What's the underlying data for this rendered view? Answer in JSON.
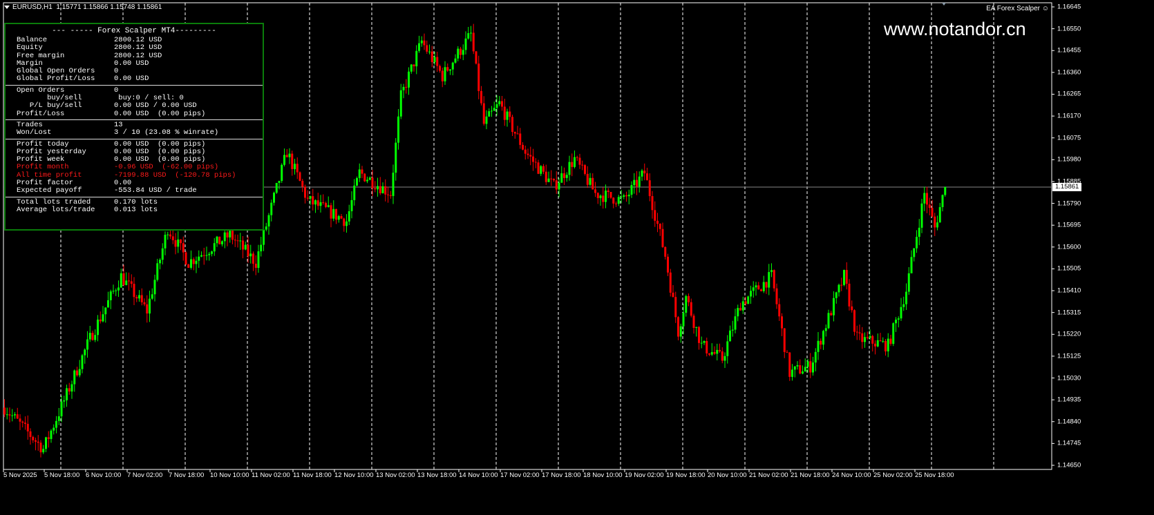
{
  "header": {
    "symbol": "EURUSD,H1",
    "ohlc": "1.15771 1.15866 1.15748 1.15861"
  },
  "ea_label": "EA Forex Scalper",
  "watermark": "www.notandor.cn",
  "panel": {
    "title": "--- ----- Forex Scalper MT4---------",
    "sections": [
      [
        [
          "Balance",
          "2800.12 USD"
        ],
        [
          "Equity",
          "2800.12 USD"
        ],
        [
          "Free margin",
          "2800.12 USD"
        ],
        [
          "Margin",
          "0.00 USD"
        ],
        [
          "Global Open Orders",
          "0"
        ],
        [
          "Global Profit/Loss",
          "0.00 USD"
        ]
      ],
      [
        [
          "Open Orders",
          "0"
        ],
        [
          "       buy/sell",
          " buy:0 / sell: 0"
        ],
        [
          "   P/L buy/sell",
          "0.00 USD / 0.00 USD"
        ],
        [
          "Profit/Loss",
          "0.00 USD  (0.00 pips)"
        ]
      ],
      [
        [
          "Trades",
          "13"
        ],
        [
          "Won/Lost",
          "3 / 10 (23.08 % winrate)"
        ]
      ],
      [
        [
          "Profit today",
          "0.00 USD  (0.00 pips)"
        ],
        [
          "Profit yesterday",
          "0.00 USD  (0.00 pips)"
        ],
        [
          "Profit week",
          "0.00 USD  (0.00 pips)"
        ],
        [
          "Profit month",
          "-0.96 USD  (-62.00 pips)",
          "red"
        ],
        [
          "All time profit",
          "-7199.88 USD  (-120.78 pips)",
          "red"
        ],
        [
          "Profit factor",
          "0.00"
        ],
        [
          "Expected payoff",
          "-553.84 USD / trade"
        ]
      ],
      [
        [
          "Total lots traded",
          "0.170 lots"
        ],
        [
          "Average lots/trade",
          "0.013 lots"
        ]
      ]
    ]
  },
  "current_price": "1.15861",
  "chart_data": {
    "type": "candlestick",
    "ylim": [
      1.1465,
      1.16645
    ],
    "yticks": [
      "1.16645",
      "1.16550",
      "1.16455",
      "1.16360",
      "1.16265",
      "1.16170",
      "1.16075",
      "1.15980",
      "1.15885",
      "1.15790",
      "1.15695",
      "1.15600",
      "1.15505",
      "1.15410",
      "1.15315",
      "1.15220",
      "1.15125",
      "1.15030",
      "1.14935",
      "1.14840",
      "1.14745",
      "1.14650"
    ],
    "xticks": [
      "5 Nov 2025",
      "5 Nov 18:00",
      "6 Nov 10:00",
      "7 Nov 02:00",
      "7 Nov 18:00",
      "10 Nov 10:00",
      "11 Nov 02:00",
      "11 Nov 18:00",
      "12 Nov 10:00",
      "13 Nov 02:00",
      "13 Nov 18:00",
      "14 Nov 10:00",
      "17 Nov 02:00",
      "17 Nov 18:00",
      "18 Nov 10:00",
      "19 Nov 02:00",
      "19 Nov 18:00",
      "20 Nov 10:00",
      "21 Nov 02:00",
      "21 Nov 18:00",
      "24 Nov 10:00",
      "25 Nov 02:00",
      "25 Nov 18:00"
    ],
    "close_path": [
      [
        0,
        1.14901
      ],
      [
        15,
        1.14721
      ],
      [
        23,
        1.14932
      ],
      [
        33,
        1.15202
      ],
      [
        45,
        1.15473
      ],
      [
        55,
        1.15322
      ],
      [
        63,
        1.15683
      ],
      [
        71,
        1.15533
      ],
      [
        87,
        1.15653
      ],
      [
        97,
        1.15533
      ],
      [
        109,
        1.16014
      ],
      [
        117,
        1.15803
      ],
      [
        132,
        1.15713
      ],
      [
        137,
        1.15924
      ],
      [
        149,
        1.15833
      ],
      [
        153,
        1.16254
      ],
      [
        161,
        1.16495
      ],
      [
        169,
        1.16344
      ],
      [
        180,
        1.16525
      ],
      [
        185,
        1.16134
      ],
      [
        191,
        1.16224
      ],
      [
        201,
        1.16014
      ],
      [
        212,
        1.15863
      ],
      [
        220,
        1.15984
      ],
      [
        228,
        1.15833
      ],
      [
        239,
        1.15803
      ],
      [
        247,
        1.15924
      ],
      [
        255,
        1.15563
      ],
      [
        260,
        1.15232
      ],
      [
        263,
        1.15383
      ],
      [
        269,
        1.15172
      ],
      [
        277,
        1.15112
      ],
      [
        284,
        1.15353
      ],
      [
        296,
        1.15473
      ],
      [
        303,
        1.15052
      ],
      [
        311,
        1.15082
      ],
      [
        324,
        1.15473
      ],
      [
        329,
        1.15202
      ],
      [
        341,
        1.15172
      ],
      [
        348,
        1.15413
      ],
      [
        355,
        1.15833
      ],
      [
        359,
        1.15683
      ],
      [
        363,
        1.15861
      ]
    ],
    "bull_color": "#00ff00",
    "bear_color": "#ff0000",
    "grid_color": "#ffffff"
  }
}
